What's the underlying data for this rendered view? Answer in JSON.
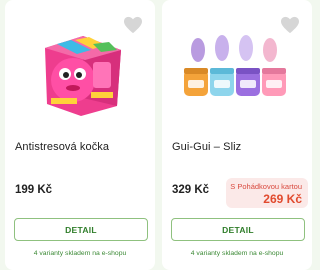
{
  "products": [
    {
      "name": "Antistresová kočka",
      "price": "199 Kč",
      "button_label": "DETAIL",
      "stock_text": "4 varianty skladem na e-shopu"
    },
    {
      "name": "Gui-Gui – Sliz",
      "price": "329 Kč",
      "promo_label": "S Pohádkovou kartou",
      "promo_price": "269 Kč",
      "button_label": "DETAIL",
      "stock_text": "4 varianty skladem na e-shopu"
    }
  ],
  "colors": {
    "accent_green": "#2f7d2a",
    "button_border": "#8fc17f",
    "promo_bg": "#fbe9e8",
    "promo_text": "#e14a2e",
    "page_bg": "#f2f8ef"
  },
  "icons": {
    "wishlist": "heart-icon"
  }
}
